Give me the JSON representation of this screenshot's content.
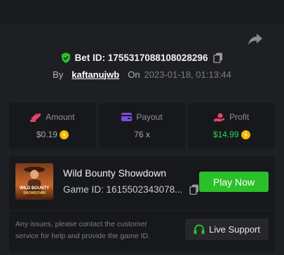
{
  "bet": {
    "id_text": "Bet ID: 1755317088108028296",
    "by_label": "By",
    "username": "kaftanujwb",
    "on_label": "On",
    "datetime": "2023-01-18, 01:13:44"
  },
  "stats": [
    {
      "label": "Amount",
      "value": "$0.19",
      "icon": "cash-icon"
    },
    {
      "label": "Payout",
      "value": "76 x",
      "icon": "wallet-icon"
    },
    {
      "label": "Profit",
      "value": "$14.99",
      "icon": "profit-hand-icon"
    }
  ],
  "game": {
    "name": "Wild Bounty Showdown",
    "id_text": "Game ID: 1615502343078...",
    "thumb_lines": [
      "WILD BOUNTY",
      "SHOWDOWN"
    ],
    "play_label": "Play Now"
  },
  "support": {
    "help_text": "Any issues, please contact the customer service for help and provide the game ID.",
    "button_label": "Live Support"
  },
  "colors": {
    "background": "#1e1f23",
    "card": "#17181b",
    "accent_green": "#2bc02a",
    "profit_green": "#2bd65a",
    "coin_gold": "#f5b800",
    "amount_icon": "#e0456b",
    "payout_icon": "#7b4dde"
  }
}
